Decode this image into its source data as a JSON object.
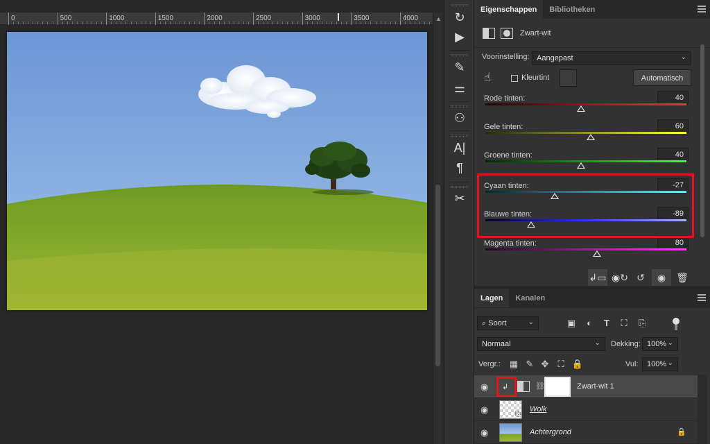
{
  "ruler": {
    "labels": [
      "0",
      "500",
      "1000",
      "1500",
      "2000",
      "2500",
      "3000",
      "3500",
      "4000"
    ]
  },
  "properties": {
    "tabs": [
      "Eigenschappen",
      "Bibliotheken"
    ],
    "adjustment_name": "Zwart-wit",
    "preset_label": "Voorinstelling:",
    "preset_value": "Aangepast",
    "tint_label": "Kleurtint",
    "tint_checked": false,
    "auto_button": "Automatisch",
    "sliders": [
      {
        "label": "Rode tinten:",
        "value": "40",
        "pos": 0.476,
        "gradient": "linear-gradient(90deg,#2a0000,#ff3030)"
      },
      {
        "label": "Gele tinten:",
        "value": "60",
        "pos": 0.524,
        "gradient": "linear-gradient(90deg,#2a2a00,#ffff40)"
      },
      {
        "label": "Groene tinten:",
        "value": "40",
        "pos": 0.476,
        "gradient": "linear-gradient(90deg,#002a00,#40ff40)"
      },
      {
        "label": "Cyaan tinten:",
        "value": "-27",
        "pos": 0.345,
        "gradient": "linear-gradient(90deg,#002a2a,#40ffff)"
      },
      {
        "label": "Blauwe tinten:",
        "value": "-89",
        "pos": 0.226,
        "gradient": "linear-gradient(90deg,#00002a,#3030ff,#aab0ff)"
      },
      {
        "label": "Magenta tinten:",
        "value": "80",
        "pos": 0.555,
        "gradient": "linear-gradient(90deg,#2a002a,#ff40ff)"
      }
    ],
    "footer_icons": [
      "clip-to-layer-icon",
      "view-previous-icon",
      "reset-icon",
      "visibility-icon",
      "trash-icon"
    ]
  },
  "layers_panel": {
    "tabs": [
      "Lagen",
      "Kanalen"
    ],
    "filter_value": "Soort",
    "blend_mode": "Normaal",
    "opacity_label": "Dekking:",
    "opacity_value": "100%",
    "lock_label": "Vergr.:",
    "fill_label": "Vul:",
    "fill_value": "100%",
    "layers": [
      {
        "name": "Zwart-wit 1",
        "type": "adjustment",
        "selected": true
      },
      {
        "name": "Wolk",
        "type": "smart-object",
        "selected": false
      },
      {
        "name": "Achtergrond",
        "type": "background",
        "selected": false,
        "locked": true
      }
    ]
  },
  "colors": {
    "panel_bg": "#323232",
    "highlight": "#e3141b",
    "sky_top": "#6f99d6",
    "grass": "#7fa42a"
  }
}
